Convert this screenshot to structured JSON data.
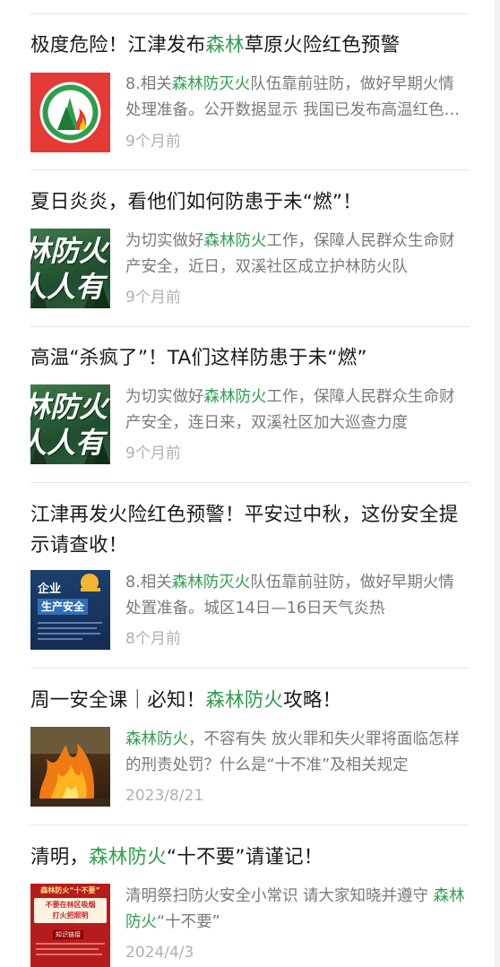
{
  "articles": [
    {
      "title_parts": [
        {
          "t": "极度危险！江津发布",
          "hl": false
        },
        {
          "t": "森林",
          "hl": true
        },
        {
          "t": "草原火险红色预警",
          "hl": false
        }
      ],
      "summary_parts": [
        {
          "t": "8.相关",
          "hl": false
        },
        {
          "t": "森林防灭火",
          "hl": true
        },
        {
          "t": "队伍靠前驻防，做好早期火情处理准备。公开数据显示 我国已发布高温红色预警",
          "hl": false
        }
      ],
      "date": "9个月前",
      "thumb": "forest-fire-warning-logo"
    },
    {
      "title_parts": [
        {
          "t": "夏日炎炎，看他们如何防患于未“燃”！",
          "hl": false
        }
      ],
      "summary_parts": [
        {
          "t": "为切实做好",
          "hl": false
        },
        {
          "t": "森林防火",
          "hl": true
        },
        {
          "t": "工作，保障人民群众生命财产安全，近日，双溪社区成立护林防火队",
          "hl": false
        }
      ],
      "date": "9个月前",
      "thumb": "forest-fireproof-poster",
      "thumb_text": [
        "林防火",
        "人人有"
      ]
    },
    {
      "title_parts": [
        {
          "t": "高温“杀疯了”！TA们这样防患于未“燃”",
          "hl": false
        }
      ],
      "summary_parts": [
        {
          "t": "为切实做好",
          "hl": false
        },
        {
          "t": "森林防火",
          "hl": true
        },
        {
          "t": "工作，保障人民群众生命财产安全，连日来，双溪社区加大巡查力度",
          "hl": false
        }
      ],
      "date": "9个月前",
      "thumb": "forest-fireproof-poster",
      "thumb_text": [
        "林防火",
        "人人有"
      ]
    },
    {
      "title_parts": [
        {
          "t": "江津再发火险红色预警！平安过中秋，这份安全提示请查收！",
          "hl": false
        }
      ],
      "summary_parts": [
        {
          "t": "8.相关",
          "hl": false
        },
        {
          "t": "森林防灭火",
          "hl": true
        },
        {
          "t": "队伍靠前驻防，做好早期火情处置准备。城区14日—16日天气炎热",
          "hl": false
        }
      ],
      "date": "8个月前",
      "thumb": "enterprise-safety-poster",
      "thumb_text": [
        "企业",
        "生产安全"
      ]
    },
    {
      "title_parts": [
        {
          "t": "周一安全课｜必知！",
          "hl": false
        },
        {
          "t": "森林防火",
          "hl": true
        },
        {
          "t": "攻略！",
          "hl": false
        }
      ],
      "summary_parts": [
        {
          "t": "森林防火",
          "hl": true
        },
        {
          "t": "，不容有失 放火罪和失火罪将面临怎样的刑责处罚？什么是“十不准”及相关规定",
          "hl": false
        }
      ],
      "date": "2023/8/21",
      "thumb": "burning-fire-photo"
    },
    {
      "title_parts": [
        {
          "t": "清明，",
          "hl": false
        },
        {
          "t": "森林防火",
          "hl": true
        },
        {
          "t": "“十不要”请谨记！",
          "hl": false
        }
      ],
      "summary_parts": [
        {
          "t": "清明祭扫防火安全小常识 请大家知晓并遵守 ",
          "hl": false
        },
        {
          "t": "森林防火",
          "hl": true
        },
        {
          "t": "“十不要”",
          "hl": false
        }
      ],
      "date": "2024/4/3",
      "thumb": "qingming-fireproof-poster",
      "thumb_text": [
        "森林防火“十不要”",
        "不要在林区吸烟",
        "打火把照明",
        "知识链接"
      ]
    }
  ],
  "colors": {
    "highlight": "#2e9e4d",
    "title": "#1a1a1a",
    "summary": "#7a7a7a",
    "date": "#b0b0b0",
    "divider": "#e6e6e6"
  }
}
